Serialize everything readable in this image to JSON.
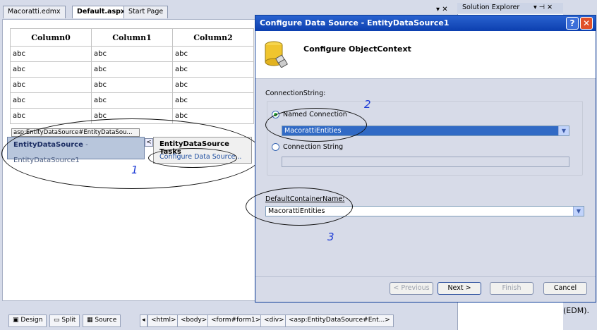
{
  "ide": {
    "doc_tabs": [
      "Macoratti.edmx",
      "Default.aspx",
      "Start Page"
    ],
    "tab_close": "▾ ✕",
    "solution_explorer": "Solution Explorer",
    "solution_controls": "▾ ⊣ ✕",
    "right_text": "(EDM)."
  },
  "grid": {
    "columns": [
      "Column0",
      "Column1",
      "Column2"
    ],
    "rows": [
      [
        "abc",
        "abc",
        "abc"
      ],
      [
        "abc",
        "abc",
        "abc"
      ],
      [
        "abc",
        "abc",
        "abc"
      ],
      [
        "abc",
        "abc",
        "abc"
      ],
      [
        "abc",
        "abc",
        "abc"
      ]
    ]
  },
  "datasource": {
    "tag": "asp:EntityDataSource#EntityDataSou...",
    "name": "EntityDataSource",
    "id": "- EntityDataSource1",
    "smart_tag": "<",
    "tasks_title": "EntityDataSource Tasks",
    "tasks_link": "Configure Data Source..."
  },
  "annotations": {
    "n1": "1",
    "n2": "2",
    "n3": "3"
  },
  "statusbar": {
    "design": "Design",
    "split": "Split",
    "source": "Source",
    "crumbs": [
      "<html>",
      "<body>",
      "<form#form1>",
      "<div>",
      "<asp:EntityDataSource#Ent...>"
    ]
  },
  "dialog": {
    "title": "Configure Data Source - EntityDataSource1",
    "help": "?",
    "close": "✕",
    "header": "Configure ObjectContext",
    "connection_label": "ConnectionString:",
    "named_connection_label": "Named Connection",
    "named_connection_value": "MacorattiEntities",
    "connection_string_label": "Connection String",
    "connection_string_value": "",
    "container_label": "DefaultContainerName:",
    "container_value": "MacorattiEntities",
    "buttons": {
      "previous": "< Previous",
      "next": "Next >",
      "finish": "Finish",
      "cancel": "Cancel"
    }
  },
  "colors": {
    "title_bar": "#0c3faf",
    "selection": "#316ac5",
    "annotation": "#1d3bd6"
  }
}
